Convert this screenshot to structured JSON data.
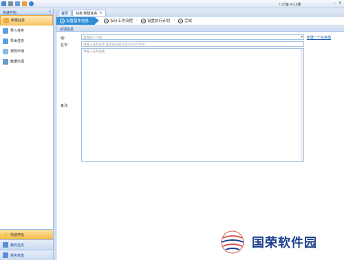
{
  "titlebar": {
    "title": "八爪鱼 4.3.5版",
    "icons": [
      "folder-icon",
      "save-icon",
      "document-icon",
      "tool-icon",
      "help-icon"
    ],
    "controls": {
      "minimize": "–",
      "close": "✕"
    }
  },
  "sidebar": {
    "header": "快速开始",
    "collapse": "«",
    "items": [
      {
        "label": "新建任务",
        "icon": "new-task-icon",
        "color": "#f2a93b"
      },
      {
        "label": "导入任务",
        "icon": "import-icon",
        "color": "#5aa0e0"
      },
      {
        "label": "导出任务",
        "icon": "export-icon",
        "color": "#5aa0e0"
      },
      {
        "label": "规则市场",
        "icon": "rule-market-icon",
        "color": "#8bb7e8"
      },
      {
        "label": "数据市场",
        "icon": "data-market-icon",
        "color": "#6c9bd2"
      }
    ],
    "bottom": [
      {
        "label": "快速开始",
        "icon": "star-icon",
        "color": "#f5c242"
      },
      {
        "label": "我的任务",
        "icon": "my-tasks-icon",
        "color": "#5a8fd6"
      },
      {
        "label": "任务状态",
        "icon": "status-icon",
        "color": "#5a8fd6"
      }
    ]
  },
  "tabs": [
    {
      "label": "首页"
    },
    {
      "label": "任务:新建任务",
      "close": "✕"
    }
  ],
  "wizard": {
    "steps": [
      {
        "num": "1",
        "label": "设置基本信息"
      },
      {
        "num": "2",
        "label": "设计工作流程"
      },
      {
        "num": "3",
        "label": "设置执行计划"
      },
      {
        "num": "4",
        "label": "完成"
      }
    ],
    "arrow": "›"
  },
  "section": {
    "title": "必填信息"
  },
  "form": {
    "group_label": "组:",
    "group_placeholder": "请选择一个组",
    "new_group_link": "新建一个任务组",
    "name_label": "名字:",
    "name_placeholder": "请输入任务名字,任务名长度必须大于4个字符",
    "note_label": "备注:",
    "note_placeholder": "请输入任务描述"
  },
  "watermark": {
    "text": "国荣软件园"
  }
}
